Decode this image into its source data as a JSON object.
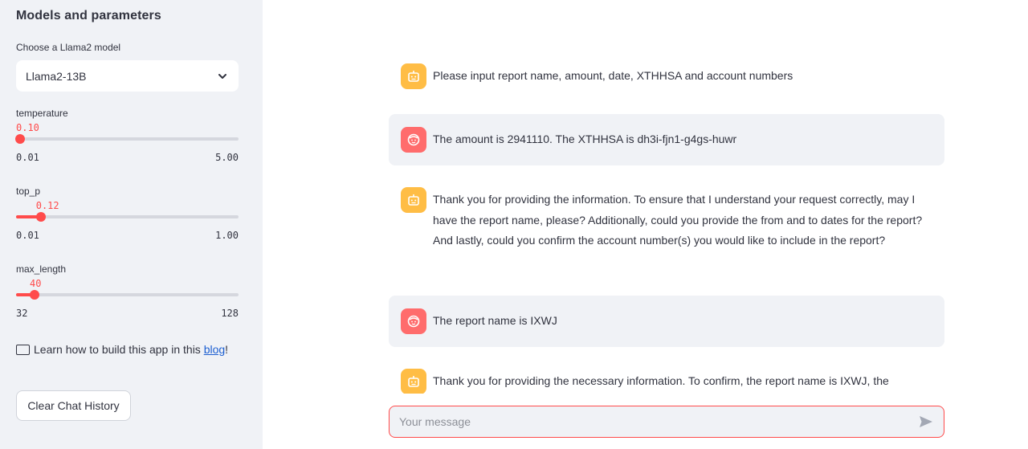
{
  "sidebar": {
    "title": "Models and parameters",
    "model_select": {
      "label": "Choose a Llama2 model",
      "value": "Llama2-13B"
    },
    "sliders": [
      {
        "label": "temperature",
        "value": "0.10",
        "min": "0.01",
        "max": "5.00",
        "fraction": 0.018
      },
      {
        "label": "top_p",
        "value": "0.12",
        "min": "0.01",
        "max": "1.00",
        "fraction": 0.111
      },
      {
        "label": "max_length",
        "value": "40",
        "min": "32",
        "max": "128",
        "fraction": 0.083
      }
    ],
    "learn": {
      "text": "Learn how to build this app in this",
      "link": "blog",
      "suffix": "!"
    },
    "clear_button": "Clear Chat History"
  },
  "chat": {
    "messages": [
      {
        "role": "assistant",
        "text": "Please input report name, amount, date, XTHHSA and account numbers"
      },
      {
        "role": "user",
        "text": "The amount is 2941110. The XTHHSA is dh3i-fjn1-g4gs-huwr"
      },
      {
        "role": "assistant",
        "text": "Thank you for providing the information. To ensure that I understand your request correctly, may I have the report name, please? Additionally, could you provide the from and to dates for the report? And lastly, could you confirm the account number(s) you would like to include in the report?"
      },
      {
        "role": "user",
        "text": "The report name is IXWJ"
      },
      {
        "role": "assistant",
        "text": "Thank you for providing the necessary information. To confirm, the report name is IXWJ, the"
      }
    ],
    "input_placeholder": "Your message"
  },
  "colors": {
    "accent": "#ff4b4b",
    "bot_avatar": "#ffbd45",
    "user_avatar": "#ff6c6c",
    "sidebar_bg": "#f0f2f6",
    "link": "#1c5fd1"
  },
  "icons": {
    "select": "chevron-down-icon",
    "bot": "robot-icon",
    "user": "face-icon",
    "send": "send-icon",
    "learn": "book-icon"
  }
}
